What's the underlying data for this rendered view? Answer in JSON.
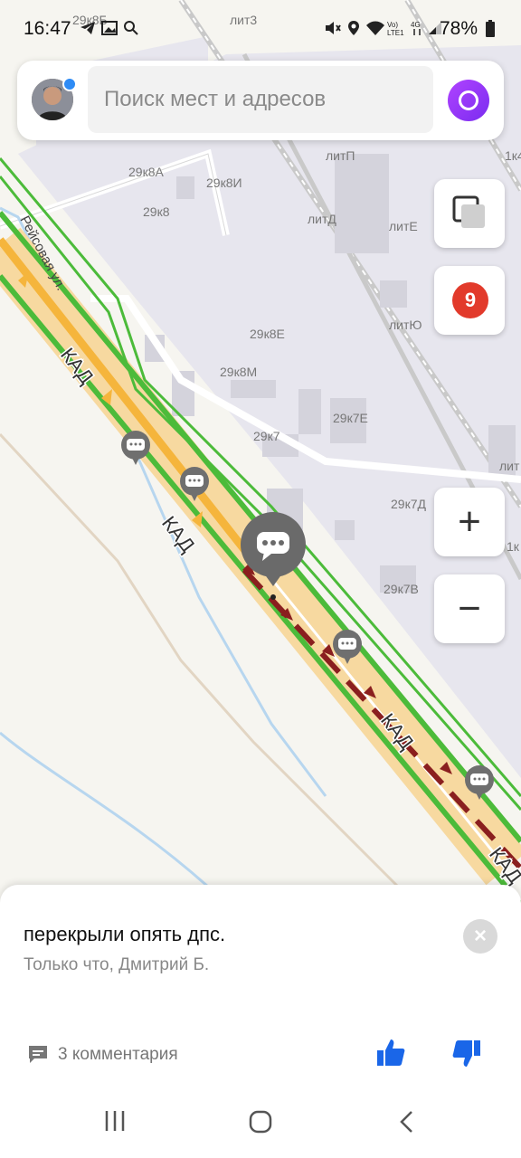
{
  "status_bar": {
    "time": "16:47",
    "battery": "78%",
    "icons": [
      "telegram-icon",
      "gallery-icon",
      "search-icon",
      "mute-icon",
      "location-icon",
      "wifi-icon",
      "volte-icon",
      "signal-icon",
      "battery-icon"
    ]
  },
  "search": {
    "placeholder": "Поиск мест и адресов"
  },
  "map": {
    "labels": {
      "b29k8b": "29к8Б",
      "lit3": "лит3",
      "lk4": "1к4",
      "l1k": "1к",
      "b29k8a": "29к8А",
      "b29k8i": "29к8И",
      "b29k8": "29к8",
      "litp": "литП",
      "litd": "литД",
      "lite": "литЕ",
      "lityu": "литЮ",
      "b29k8e": "29к8Е",
      "b29k8m": "29к8М",
      "b29k7e": "29к7Е",
      "b29k7": "29к7",
      "b29k7d": "29к7Д",
      "b29k7v": "29к7В",
      "lit_right": "лит",
      "l1k_right": "1к",
      "street": "Рейсовая ул.",
      "kad1": "КАД",
      "kad2": "КАД",
      "kad3": "КАД",
      "kad4": "КАД"
    },
    "traffic_level": "9",
    "colors": {
      "road_fast": "#4cbb3a",
      "road_medium": "#f5b53c",
      "road_slow": "#8a1f1f",
      "road_base": "#f7d9a0",
      "industrial": "#e7e6ee",
      "background": "#f6f5f0"
    }
  },
  "event": {
    "message": "перекрыли опять дпс.",
    "meta": "Только что, Дмитрий Б.",
    "comments": "3 комментария"
  },
  "nav_bar": {
    "icons": [
      "recent-apps-icon",
      "home-icon",
      "back-icon"
    ]
  }
}
